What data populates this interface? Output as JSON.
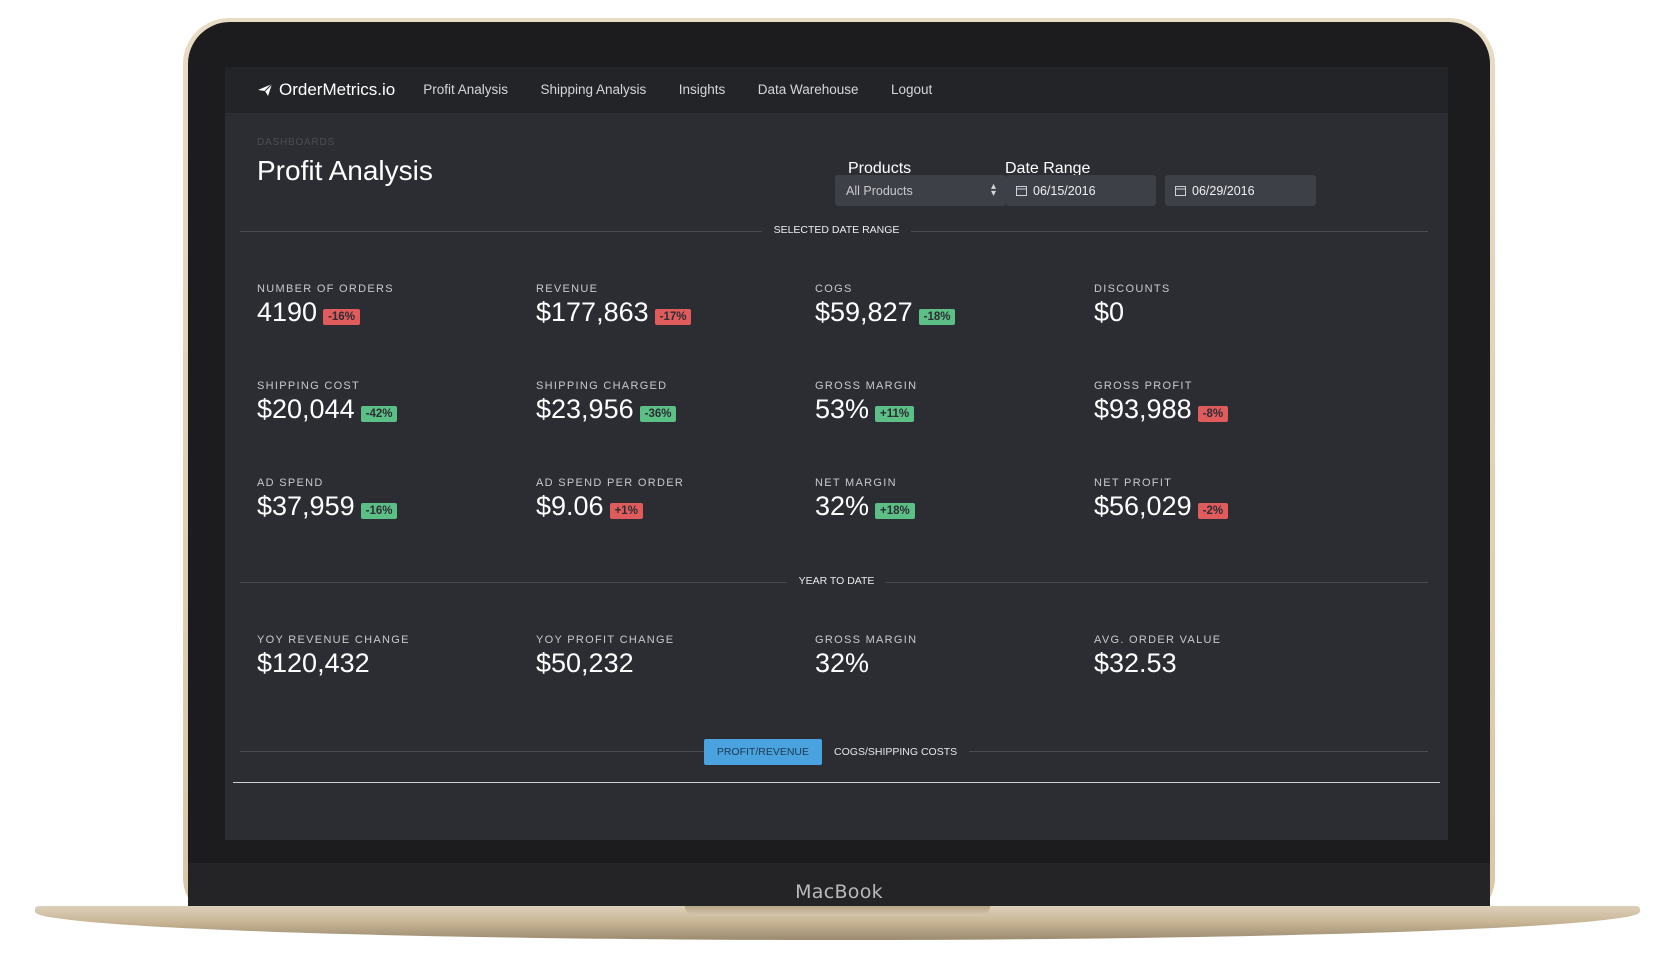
{
  "app": {
    "logo_text": "OrderMetrics.io",
    "device_label": "MacBook"
  },
  "nav": {
    "items": [
      "Profit Analysis",
      "Shipping Analysis",
      "Insights",
      "Data Warehouse",
      "Logout"
    ]
  },
  "page": {
    "breadcrumb": "DASHBOARDS",
    "title": "Profit Analysis"
  },
  "filters": {
    "products_label": "Products",
    "products_value": "All Products",
    "date_range_label": "Date Range",
    "start_date": "06/15/2016",
    "end_date": "06/29/2016"
  },
  "sections": {
    "selected": "SELECTED DATE RANGE",
    "ytd": "YEAR TO DATE"
  },
  "metrics_selected": [
    {
      "label": "NUMBER OF ORDERS",
      "value": "4190",
      "change": "-16%",
      "status": "red"
    },
    {
      "label": "REVENUE",
      "value": "$177,863",
      "change": "-17%",
      "status": "red"
    },
    {
      "label": "COGS",
      "value": "$59,827",
      "change": "-18%",
      "status": "green"
    },
    {
      "label": "DISCOUNTS",
      "value": "$0",
      "change": "",
      "status": ""
    },
    {
      "label": "SHIPPING COST",
      "value": "$20,044",
      "change": "-42%",
      "status": "green"
    },
    {
      "label": "SHIPPING CHARGED",
      "value": "$23,956",
      "change": "-36%",
      "status": "green"
    },
    {
      "label": "GROSS MARGIN",
      "value": "53%",
      "change": "+11%",
      "status": "green"
    },
    {
      "label": "GROSS PROFIT",
      "value": "$93,988",
      "change": "-8%",
      "status": "red"
    },
    {
      "label": "AD SPEND",
      "value": "$37,959",
      "change": "-16%",
      "status": "green"
    },
    {
      "label": "AD SPEND PER ORDER",
      "value": "$9.06",
      "change": "+1%",
      "status": "red"
    },
    {
      "label": "NET MARGIN",
      "value": "32%",
      "change": "+18%",
      "status": "green"
    },
    {
      "label": "NET PROFIT",
      "value": "$56,029",
      "change": "-2%",
      "status": "red"
    }
  ],
  "metrics_ytd": [
    {
      "label": "YOY REVENUE CHANGE",
      "value": "$120,432"
    },
    {
      "label": "YOY PROFIT CHANGE",
      "value": "$50,232"
    },
    {
      "label": "GROSS MARGIN",
      "value": "32%"
    },
    {
      "label": "AVG. ORDER VALUE",
      "value": "$32.53"
    }
  ],
  "tabs": {
    "active": "PROFIT/REVENUE",
    "inactive": "COGS/SHIPPING COSTS"
  },
  "colors": {
    "accent": "#4aa3df",
    "badge_red": "#e05b5b",
    "badge_green": "#5cbf86",
    "screen_bg": "#2b2d33"
  }
}
